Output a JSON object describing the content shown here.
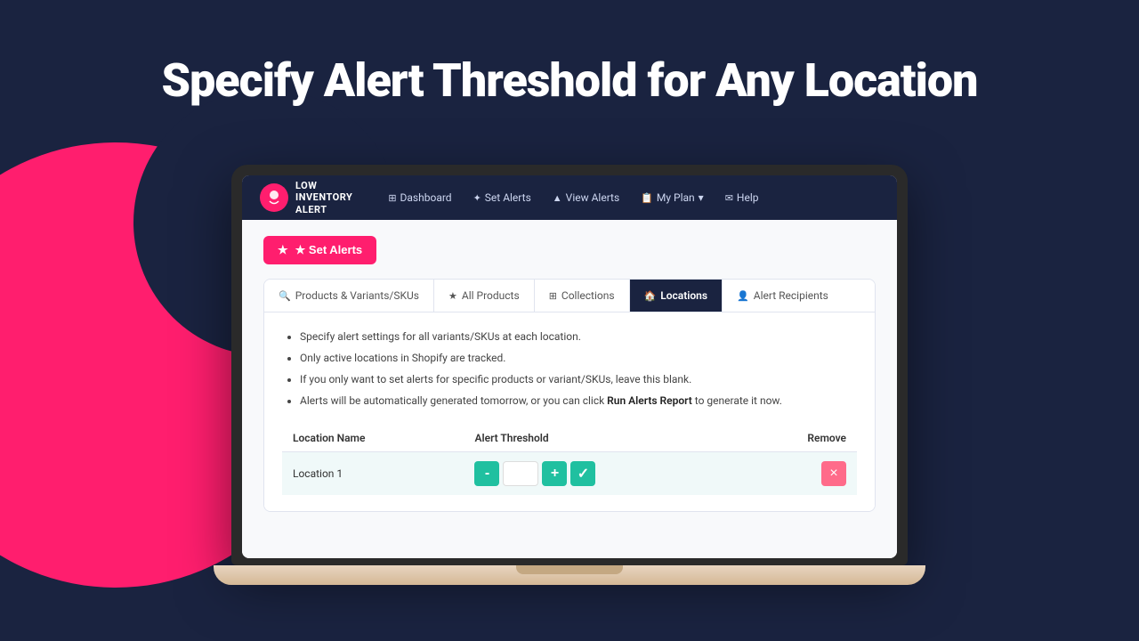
{
  "page": {
    "heading": "Specify Alert Threshold for Any Location",
    "background_color": "#1a2340",
    "accent_color": "#ff1e6e"
  },
  "app": {
    "logo": {
      "text_line1": "LOW",
      "text_line2": "INVENTORY",
      "text_line3": "ALERT",
      "icon_symbol": "🔔"
    },
    "navbar": {
      "links": [
        {
          "label": "Dashboard",
          "icon": "⊞"
        },
        {
          "label": "Set Alerts",
          "icon": "✦"
        },
        {
          "label": "View Alerts",
          "icon": "▲"
        },
        {
          "label": "My Plan",
          "icon": "📋",
          "has_dropdown": true
        },
        {
          "label": "Help",
          "icon": "✉"
        }
      ]
    },
    "set_alerts_button": "★  Set Alerts",
    "tabs": [
      {
        "id": "products-variants",
        "label": "Products & Variants/SKUs",
        "icon": "🔍",
        "active": false
      },
      {
        "id": "all-products",
        "label": "All Products",
        "icon": "★",
        "active": false
      },
      {
        "id": "collections",
        "label": "Collections",
        "icon": "⊞",
        "active": false
      },
      {
        "id": "locations",
        "label": "Locations",
        "icon": "🏠",
        "active": true
      },
      {
        "id": "alert-recipients",
        "label": "Alert Recipients",
        "icon": "👤",
        "active": false
      }
    ],
    "locations_tab": {
      "info_bullets": [
        "Specify alert settings for all variants/SKUs at each location.",
        "Only active locations in Shopify are tracked.",
        "If you only want to set alerts for specific products or variant/SKUs, leave this blank.",
        "Alerts will be automatically generated tomorrow, or you can click Run Alerts Report to generate it now."
      ],
      "run_alerts_link_text": "Run Alerts Report",
      "table": {
        "headers": [
          "Location Name",
          "Alert Threshold",
          "Remove"
        ],
        "rows": [
          {
            "location_name": "Location 1",
            "threshold_value": "",
            "id": "loc1"
          }
        ]
      },
      "controls": {
        "minus_label": "-",
        "plus_label": "+",
        "check_label": "✓",
        "remove_label": "×"
      }
    }
  }
}
